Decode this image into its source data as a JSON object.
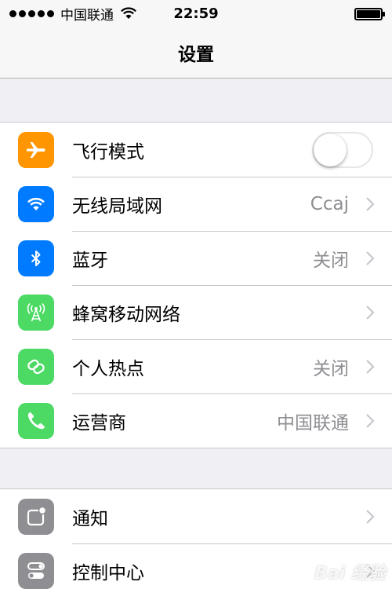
{
  "status_bar": {
    "carrier": "中国联通",
    "time": "22:59",
    "signal_bars": 5,
    "battery_level": 1.0
  },
  "nav": {
    "title": "设置"
  },
  "groups": [
    {
      "items": [
        {
          "label": "飞行模式",
          "icon": "airplane-icon",
          "icon_color": "#ff9500",
          "toggle_on": false
        },
        {
          "label": "无线局域网",
          "icon": "wifi-icon",
          "icon_color": "#007aff",
          "value": "Ccaj"
        },
        {
          "label": "蓝牙",
          "icon": "bluetooth-icon",
          "icon_color": "#007aff",
          "value": "关闭"
        },
        {
          "label": "蜂窝移动网络",
          "icon": "cellular-antenna-icon",
          "icon_color": "#4cd964",
          "value": ""
        },
        {
          "label": "个人热点",
          "icon": "hotspot-link-icon",
          "icon_color": "#4cd964",
          "value": "关闭"
        },
        {
          "label": "运营商",
          "icon": "phone-icon",
          "icon_color": "#4cd964",
          "value": "中国联通"
        }
      ]
    },
    {
      "items": [
        {
          "label": "通知",
          "icon": "notifications-icon",
          "icon_color": "#8e8e93"
        },
        {
          "label": "控制中心",
          "icon": "control-center-icon",
          "icon_color": "#8e8e93"
        }
      ]
    }
  ],
  "watermark": "Bai 经验"
}
